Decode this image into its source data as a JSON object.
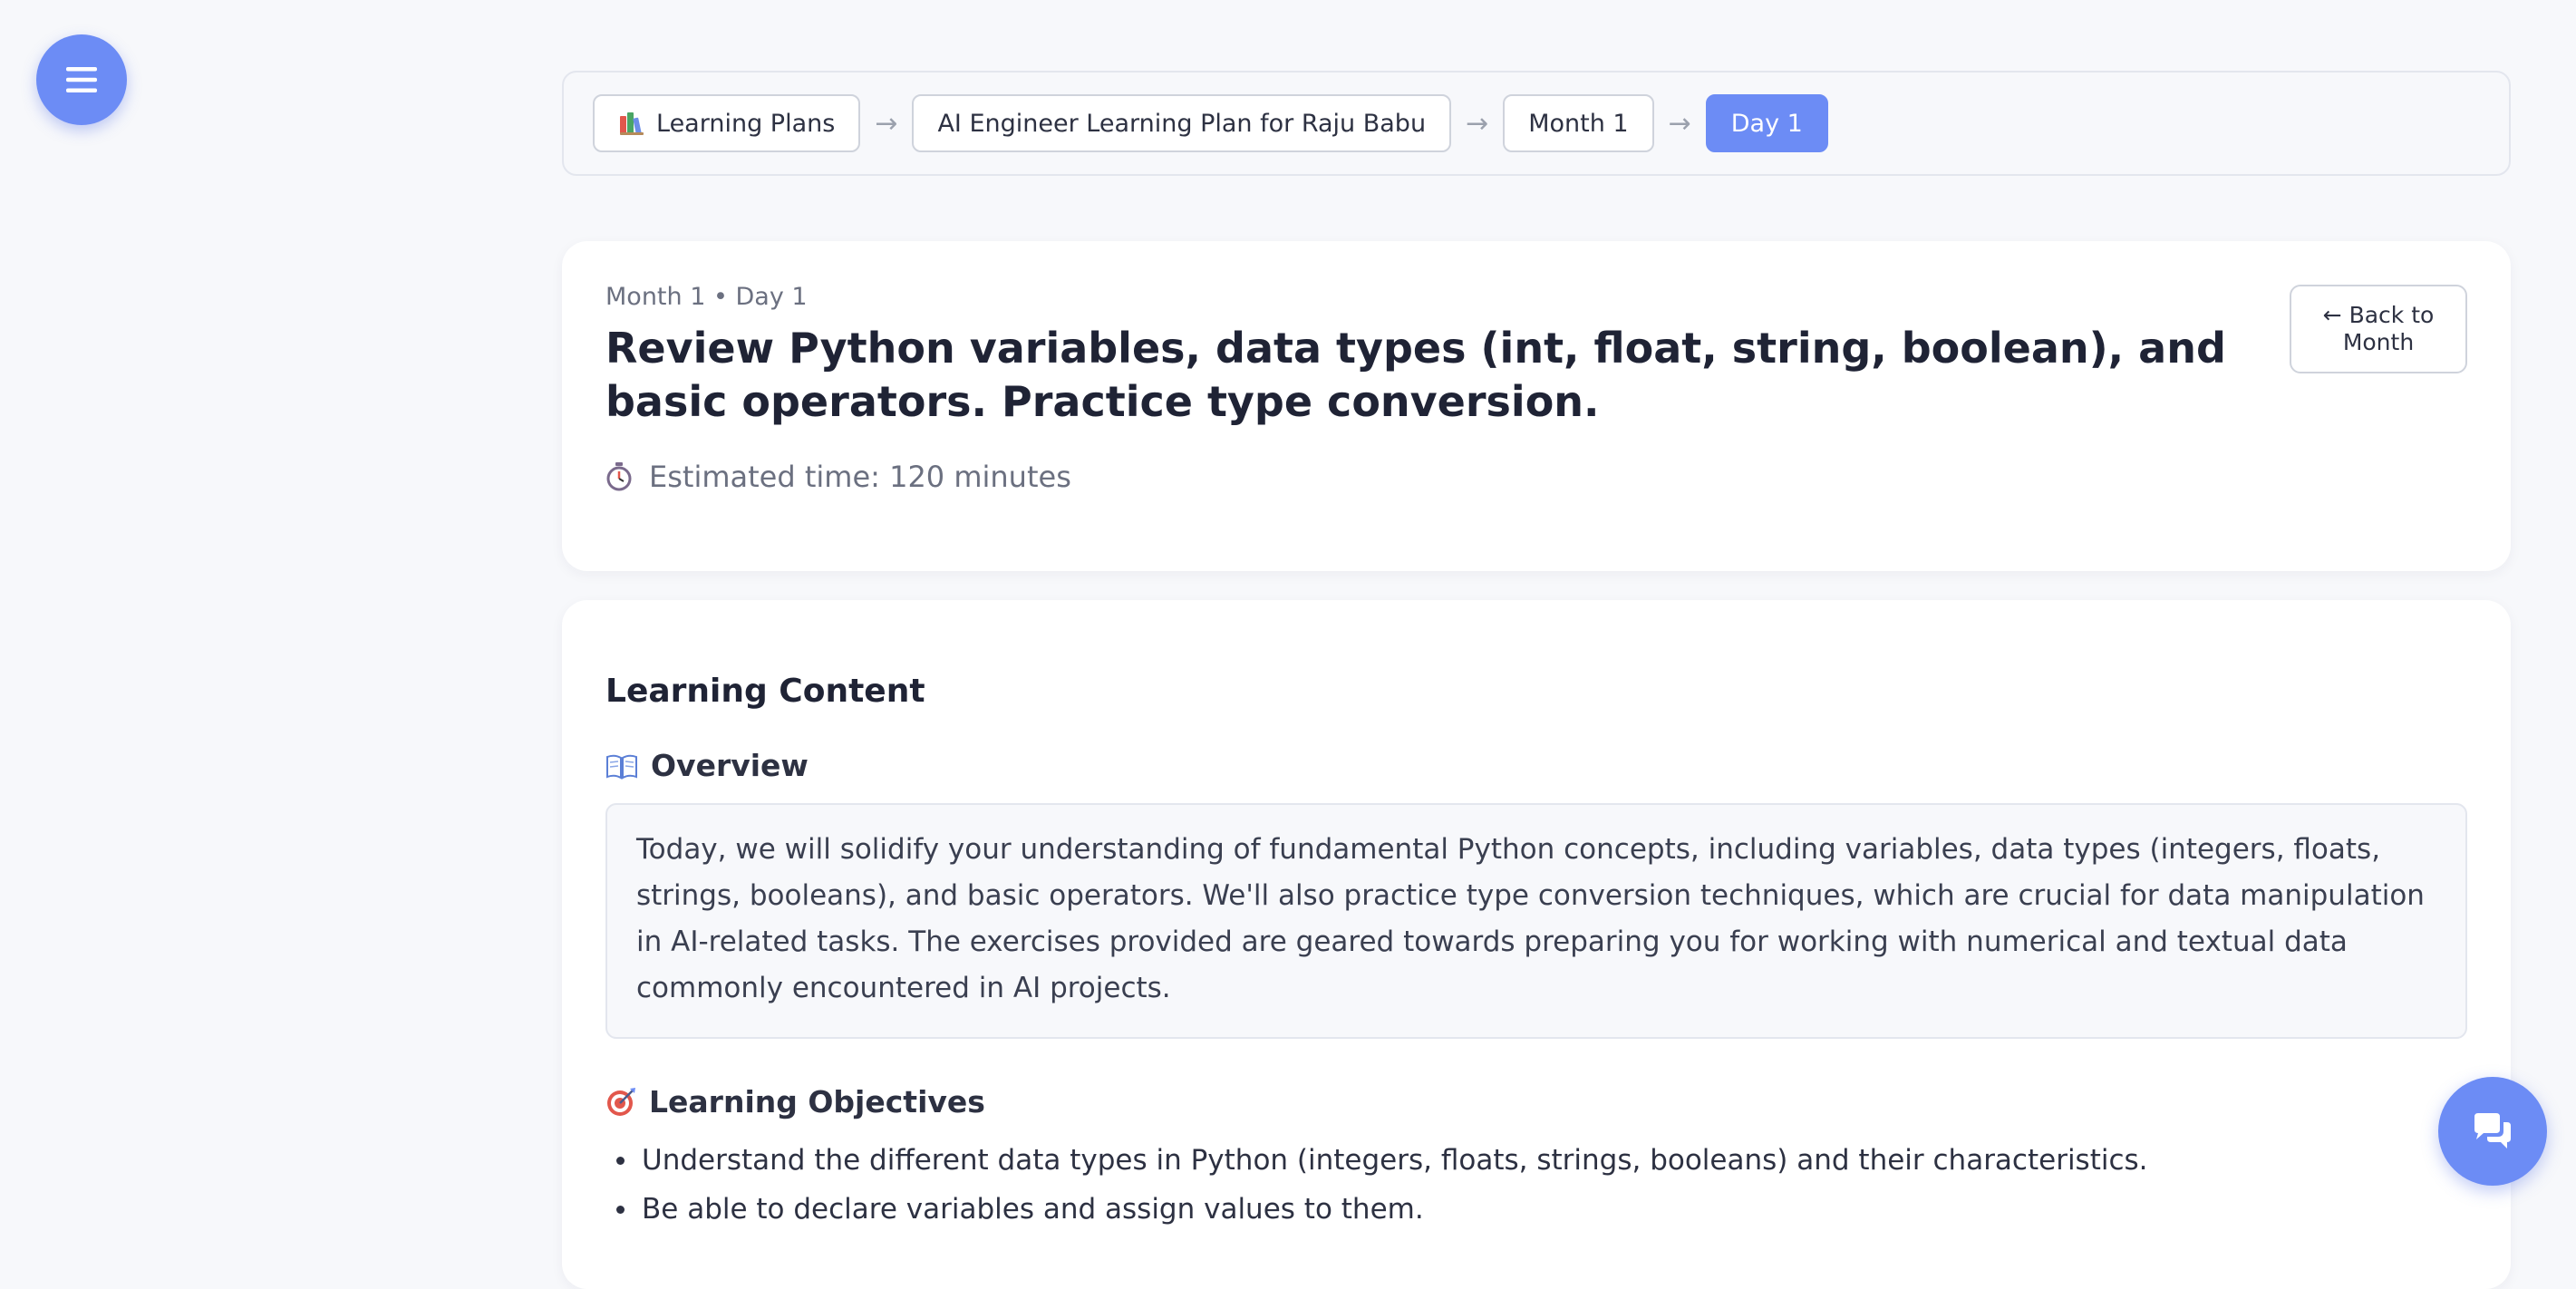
{
  "icons": {
    "menu": "hamburger-icon",
    "chat": "chat-bubbles-icon",
    "books": "books-icon",
    "stopwatch": "stopwatch-icon",
    "overview": "open-book-icon",
    "objectives": "target-icon"
  },
  "colors": {
    "accent": "#6c8cf5",
    "background": "#f7f8fb",
    "card": "#ffffff",
    "text": "#1f2335",
    "muted": "#6b7080"
  },
  "breadcrumb": {
    "items": [
      {
        "label": "Learning Plans"
      },
      {
        "label": "AI Engineer Learning Plan for Raju Babu"
      },
      {
        "label": "Month 1"
      },
      {
        "label": "Day 1"
      }
    ],
    "separator": "→"
  },
  "header": {
    "meta": "Month 1 • Day 1",
    "title": "Review Python variables, data types (int, float, string, boolean), and basic operators. Practice type conversion.",
    "estimated_time": "Estimated time: 120 minutes",
    "back_button": "← Back to\nMonth"
  },
  "content": {
    "section_title": "Learning Content",
    "overview_title": "Overview",
    "overview_text": "Today, we will solidify your understanding of fundamental Python concepts, including variables, data types (integers, floats, strings, booleans), and basic operators. We'll also practice type conversion techniques, which are crucial for data manipulation in AI-related tasks. The exercises provided are geared towards preparing you for working with numerical and textual data commonly encountered in AI projects.",
    "objectives_title": "Learning Objectives",
    "objectives": [
      "Understand the different data types in Python (integers, floats, strings, booleans) and their characteristics.",
      "Be able to declare variables and assign values to them."
    ]
  }
}
